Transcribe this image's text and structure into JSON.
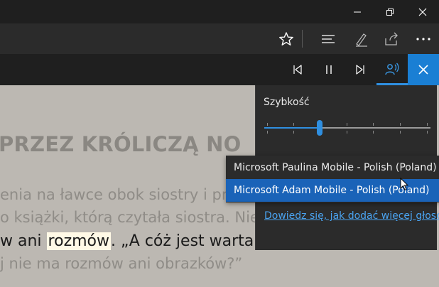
{
  "reader": {
    "heading": "PRZEZ KRÓLICZĄ NO",
    "lines": [
      "enia na ławce obok siostry i próżn",
      "o książki, którą czytała siostra. Nie",
      "ani",
      "rozmów",
      ". „A cóż jest warta ks",
      "j nie ma rozmów ani obrazków?”"
    ]
  },
  "voice_panel": {
    "speed_label": "Szybkość",
    "speed_value_fraction": 0.33,
    "voices": [
      "Microsoft Paulina Mobile - Polish (Poland)",
      "Microsoft Adam Mobile - Polish (Poland)"
    ],
    "selected_voice_index": 1,
    "help_link": "Dowiedz się, jak dodać więcej głosć"
  },
  "colors": {
    "accent": "#1a7fd4",
    "selected": "#1a63b8",
    "link": "#4aa3f0"
  }
}
